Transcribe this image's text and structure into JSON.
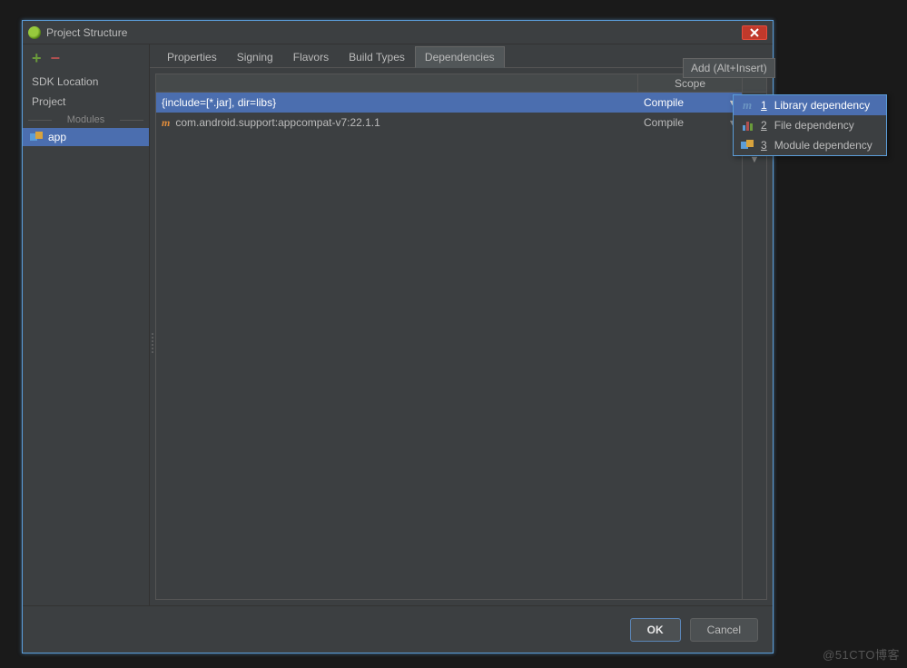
{
  "window": {
    "title": "Project Structure"
  },
  "sidebar": {
    "items": [
      "SDK Location",
      "Project"
    ],
    "modules_label": "Modules",
    "module": "app"
  },
  "tabs": {
    "items": [
      "Properties",
      "Signing",
      "Flavors",
      "Build Types",
      "Dependencies"
    ],
    "active_index": 4
  },
  "deps": {
    "scope_header": "Scope",
    "rows": [
      {
        "name": "{include=[*.jar], dir=libs}",
        "scope": "Compile",
        "icon": "none"
      },
      {
        "name": "com.android.support:appcompat-v7:22.1.1",
        "scope": "Compile",
        "icon": "m"
      }
    ]
  },
  "tooltip": "Add (Alt+Insert)",
  "popup": {
    "items": [
      {
        "num": "1",
        "label": "Library dependency",
        "icon": "m"
      },
      {
        "num": "2",
        "label": "File dependency",
        "icon": "bars"
      },
      {
        "num": "3",
        "label": "Module dependency",
        "icon": "mod"
      }
    ]
  },
  "buttons": {
    "ok": "OK",
    "cancel": "Cancel"
  },
  "watermark": "@51CTO博客"
}
